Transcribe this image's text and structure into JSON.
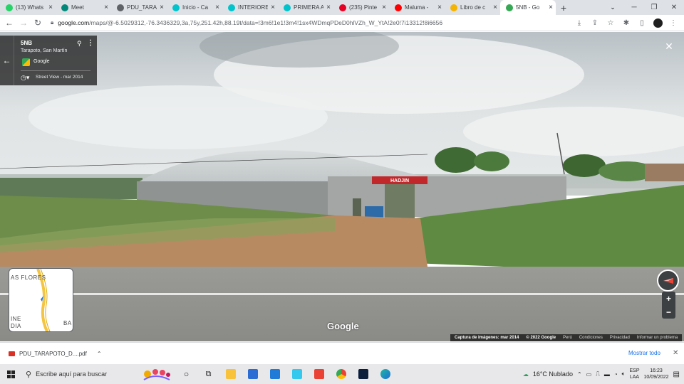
{
  "tabs": [
    {
      "label": "(13) Whats",
      "icon": "whatsapp-icon",
      "color": "#25d366"
    },
    {
      "label": "Meet",
      "icon": "meet-icon",
      "color": "#00897b"
    },
    {
      "label": "PDU_TARA",
      "icon": "globe-icon",
      "color": "#5f6368"
    },
    {
      "label": "Inicio - Ca",
      "icon": "canva-icon",
      "color": "#00c4cc"
    },
    {
      "label": "INTERIORE",
      "icon": "canva-icon",
      "color": "#00c4cc"
    },
    {
      "label": "PRIMERA A",
      "icon": "canva-icon",
      "color": "#00c4cc"
    },
    {
      "label": "(235) Pinte",
      "icon": "pinterest-icon",
      "color": "#e60023"
    },
    {
      "label": "Maluma - ",
      "icon": "youtube-icon",
      "color": "#ff0000"
    },
    {
      "label": "Libro de c",
      "icon": "sheets-icon",
      "color": "#f4b400"
    },
    {
      "label": "5NB - Go",
      "icon": "maps-icon",
      "color": "#34a853",
      "active": true
    }
  ],
  "address": {
    "url_main": "google.com",
    "url_rest": "/maps/@-6.5029312,-76.3436329,3a,75y,251.42h,88.19t/data=!3m6!1e1!3m4!1sx4WDmqPDeD0hlVZh_W_YtA!2e0!7i13312!8i6656"
  },
  "streetview": {
    "place_title": "5NB",
    "place_subtitle": "Tarapoto, San Martín",
    "source": "Google",
    "capture": "Street View - mar 2014",
    "building_sign": "HADJIN",
    "watermark": "Google"
  },
  "minimap": {
    "label_top": "AS FLORES",
    "label_bottom_left_1": "INE",
    "label_bottom_left_2": "DIA",
    "label_bottom_right": "BA"
  },
  "attribution": {
    "capture": "Captura de imágenes: mar 2014",
    "copyright": "© 2022 Google",
    "country": "Perú",
    "terms": "Condiciones",
    "privacy": "Privacidad",
    "report": "Informar un problema"
  },
  "downloads": {
    "file": "PDU_TARAPOTO_D....pdf",
    "show_all": "Mostrar todo"
  },
  "taskbar": {
    "search_placeholder": "Escribe aquí para buscar",
    "weather": "16°C  Nublado",
    "lang_1": "ESP",
    "lang_2": "LAA",
    "time": "16:23",
    "date": "10/09/2022"
  },
  "colors": {
    "accent": "#1a73e8",
    "sign_red": "#c0282b"
  }
}
